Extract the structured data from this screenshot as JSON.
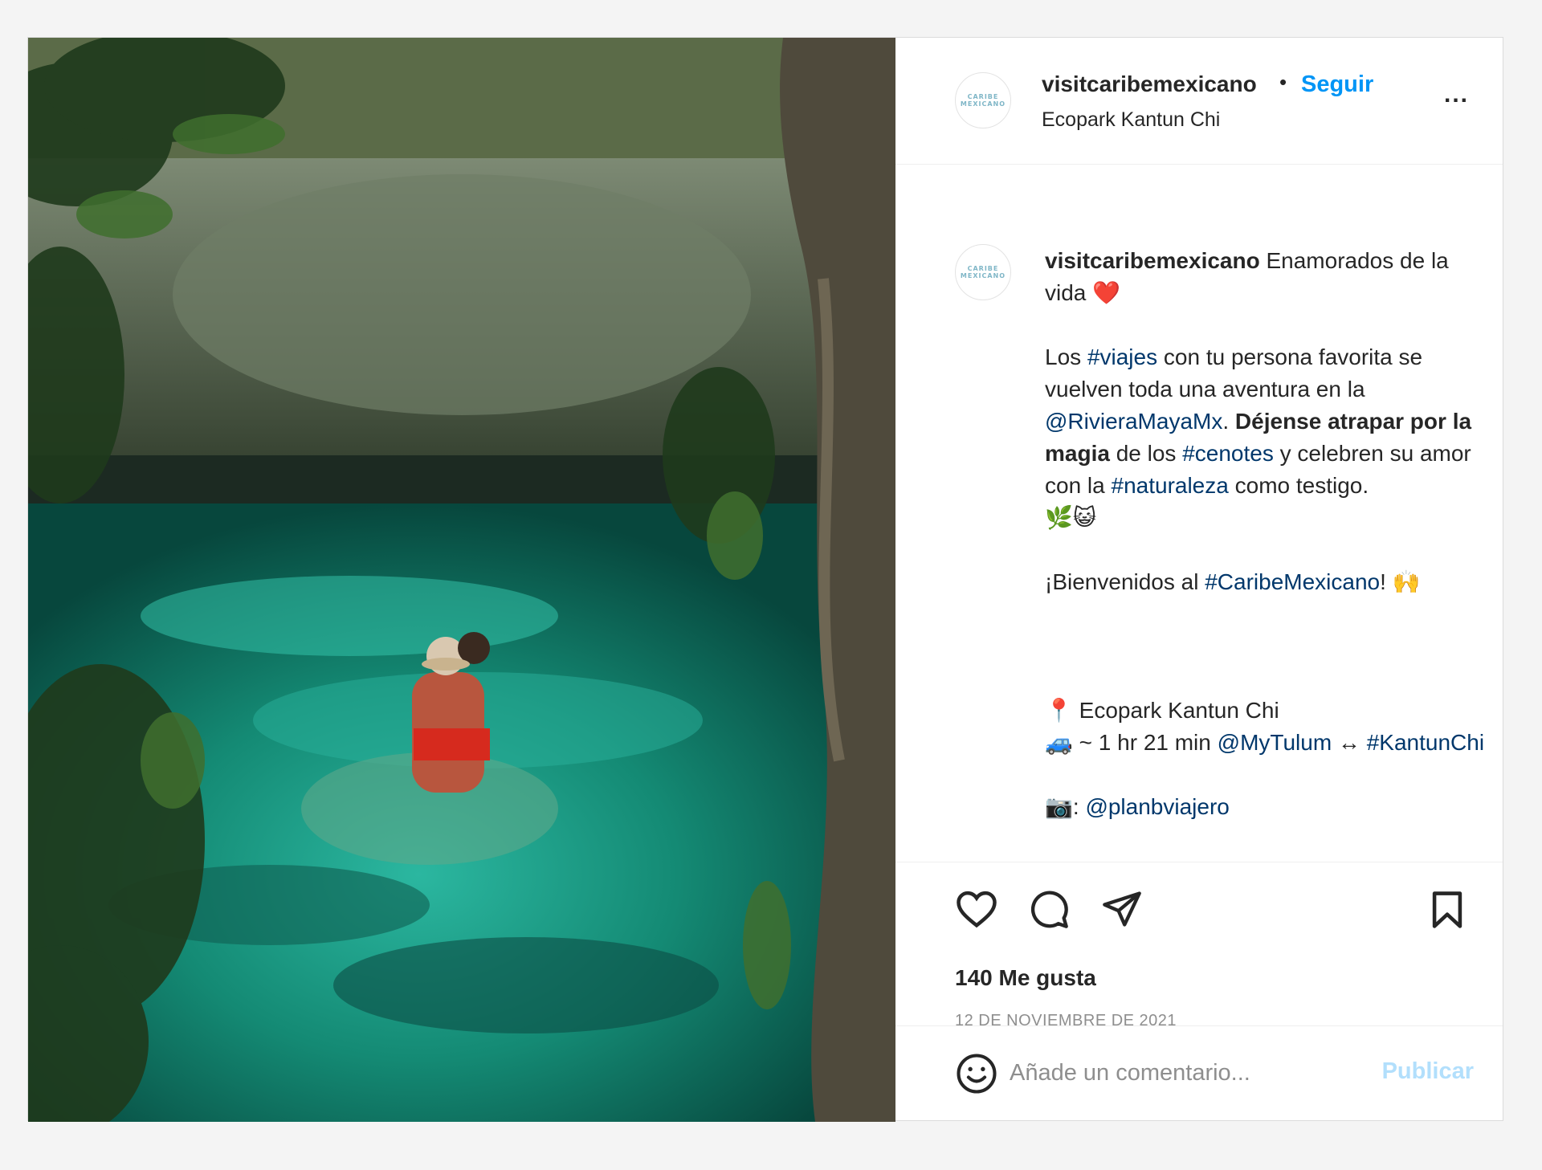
{
  "post": {
    "username": "visitcaribemexicano",
    "follow_label": "Seguir",
    "separator": "•",
    "location": "Ecopark Kantun Chi",
    "more_label": "...",
    "avatar_text": "CARIBE MEXICANO",
    "photo_icon": "cenote-photo"
  },
  "caption": {
    "username": "visitcaribemexicano",
    "title": "Enamorados de la vida",
    "heart": "❤️",
    "line1_a": "Los ",
    "tag_viajes": "#viajes",
    "line1_b": " con tu persona favorita se vuelven toda una aventura en la ",
    "mention_riviera": "@RivieraMayaMx",
    "line1_c": ". ",
    "bold_text": "Déjense atrapar por la magia",
    "line1_d": " de los ",
    "tag_cenotes": "#cenotes",
    "line1_e": " y celebren su amor con la ",
    "tag_naturaleza": "#naturaleza",
    "line1_f": " como testigo.",
    "emojis_1": "🌿😺",
    "welcome_a": "¡Bienvenidos al ",
    "tag_caribe": "#CaribeMexicano",
    "welcome_b": "! 🙌",
    "pin": "📍",
    "pin_text": " Ecopark Kantun Chi",
    "car": "🚙",
    "route_a": " ~ 1 hr 21 min ",
    "mention_tulum": "@MyTulum",
    "route_b": " ↔ ",
    "tag_kantun": "#KantunChi",
    "camera": "📷",
    "camera_a": ": ",
    "mention_plan": "@planbviajero"
  },
  "actions": {
    "like_icon": "heart-icon",
    "comment_icon": "comment-icon",
    "share_icon": "share-icon",
    "save_icon": "bookmark-icon",
    "likes": "140 Me gusta",
    "date": "12 DE NOVIEMBRE DE 2021"
  },
  "comment": {
    "emoji_icon": "smiley-icon",
    "placeholder": "Añade un comentario...",
    "publish_label": "Publicar"
  },
  "colors": {
    "accent": "#0095f6",
    "hashtag": "#00376b",
    "publish_disabled": "#b2dffc",
    "muted": "#8e8e8e"
  }
}
